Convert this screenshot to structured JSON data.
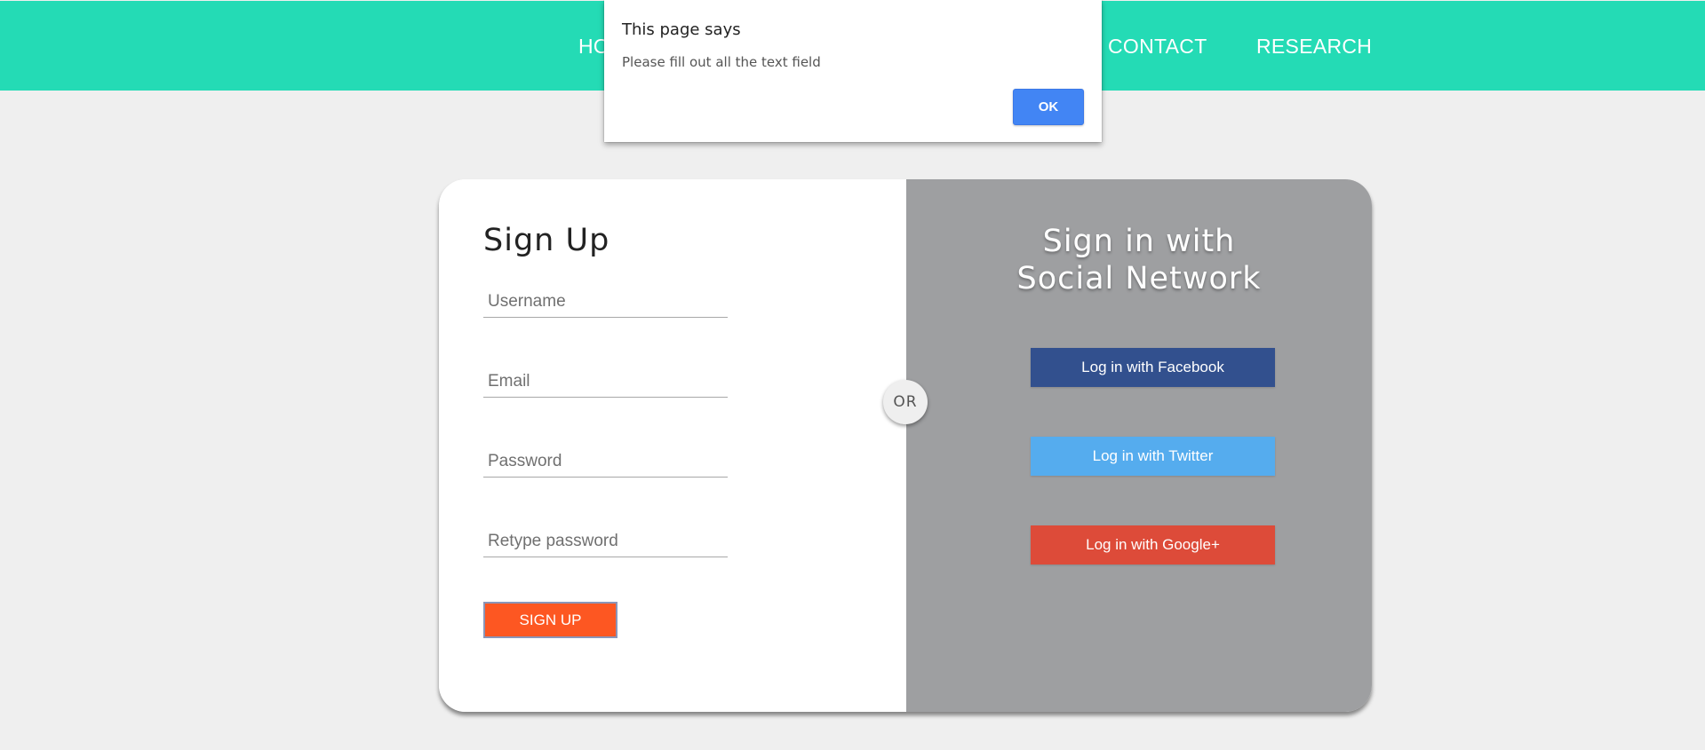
{
  "nav": {
    "items": [
      {
        "label": "HOME"
      },
      {
        "label": "CONTACT"
      },
      {
        "label": "RESEARCH"
      }
    ]
  },
  "dialog": {
    "title": "This page says",
    "message": "Please fill out all the text field",
    "ok_label": "OK"
  },
  "signup": {
    "title": "Sign Up",
    "fields": {
      "username": {
        "placeholder": "Username",
        "value": ""
      },
      "email": {
        "placeholder": "Email",
        "value": ""
      },
      "password": {
        "placeholder": "Password",
        "value": ""
      },
      "retype_password": {
        "placeholder": "Retype password",
        "value": ""
      }
    },
    "button_label": "SIGN UP"
  },
  "divider": {
    "label": "OR"
  },
  "social": {
    "title_line1": "Sign in with",
    "title_line2": "Social Network",
    "buttons": {
      "facebook": "Log in with Facebook",
      "twitter": "Log in with Twitter",
      "google": "Log in with Google+"
    }
  },
  "colors": {
    "nav_background": "#24dbb5",
    "page_background": "#efefef",
    "signup_button": "#fd5722",
    "social_panel": "#9e9fa1",
    "facebook": "#32508e",
    "twitter": "#55acee",
    "google": "#dd4b39",
    "dialog_ok": "#4285f4"
  }
}
